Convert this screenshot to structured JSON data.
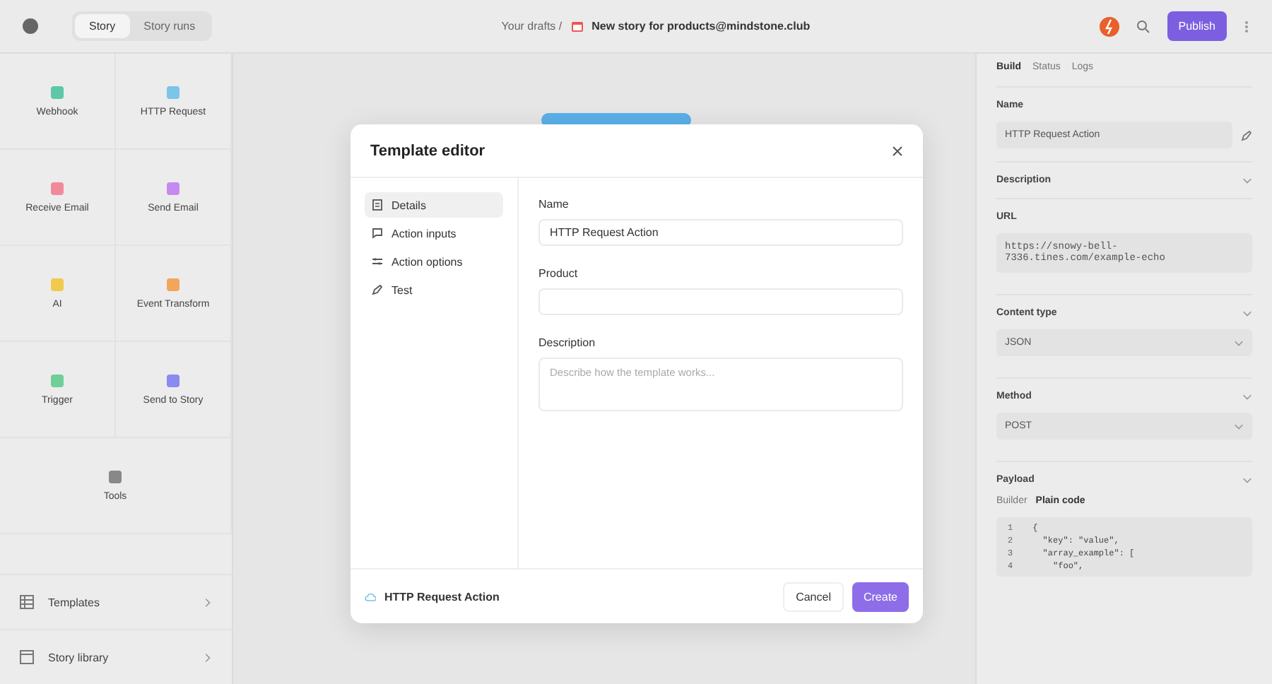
{
  "topbar": {
    "tabs": [
      {
        "label": "Story",
        "selected": true
      },
      {
        "label": "Story runs",
        "selected": false
      }
    ],
    "breadcrumb": "Your drafts /",
    "story_title": "New story for products@mindstone.club",
    "publish": "Publish"
  },
  "tools": [
    {
      "label": "Webhook",
      "color": "#5cc8a8"
    },
    {
      "label": "HTTP Request",
      "color": "#7cc4e8"
    },
    {
      "label": "Receive Email",
      "color": "#f08a9a"
    },
    {
      "label": "Send Email",
      "color": "#c58af0"
    },
    {
      "label": "AI",
      "color": "#f2c94c"
    },
    {
      "label": "Event Transform",
      "color": "#f2a65a"
    },
    {
      "label": "Trigger",
      "color": "#6fcf97"
    },
    {
      "label": "Send to Story",
      "color": "#8a8af0"
    },
    {
      "label": "Tools",
      "color": "#888888"
    }
  ],
  "sidebar_links": [
    {
      "label": "Templates"
    },
    {
      "label": "Story library"
    }
  ],
  "panel": {
    "tabs": [
      {
        "label": "Build",
        "selected": true
      },
      {
        "label": "Status",
        "selected": false
      },
      {
        "label": "Logs",
        "selected": false
      }
    ],
    "name_label": "Name",
    "name_value": "HTTP Request Action",
    "description_label": "Description",
    "url_label": "URL",
    "url_lines": [
      "https://snowy-bell-",
      "7336.tines.com/example-echo"
    ],
    "content_type_label": "Content type",
    "content_type": "JSON",
    "method_label": "Method",
    "method": "POST",
    "payload_label": "Payload",
    "payload_modes": [
      {
        "label": "Builder",
        "selected": false
      },
      {
        "label": "Plain code",
        "selected": true
      }
    ],
    "code": [
      {
        "number": "1",
        "text": "{"
      },
      {
        "number": "2",
        "text": "  \"key\": \"value\","
      },
      {
        "number": "3",
        "text": "  \"array_example\": ["
      },
      {
        "number": "4",
        "text": "    \"foo\","
      }
    ]
  },
  "modal": {
    "title": "Template editor",
    "nav": [
      {
        "label": "Details",
        "selected": true,
        "kind": "details"
      },
      {
        "label": "Action inputs",
        "selected": false,
        "kind": "inputs"
      },
      {
        "label": "Action options",
        "selected": false,
        "kind": "options"
      },
      {
        "label": "Test",
        "selected": false,
        "kind": "test"
      }
    ],
    "fields": [
      {
        "label": "Name",
        "value": "HTTP Request Action",
        "kind": "input"
      },
      {
        "label": "Product",
        "kind": "input"
      },
      {
        "label": "Description",
        "placeholder": "Describe how the template works...",
        "kind": "textarea"
      }
    ],
    "footer_label": "HTTP Request Action",
    "cancel": "Cancel",
    "create": "Create"
  }
}
